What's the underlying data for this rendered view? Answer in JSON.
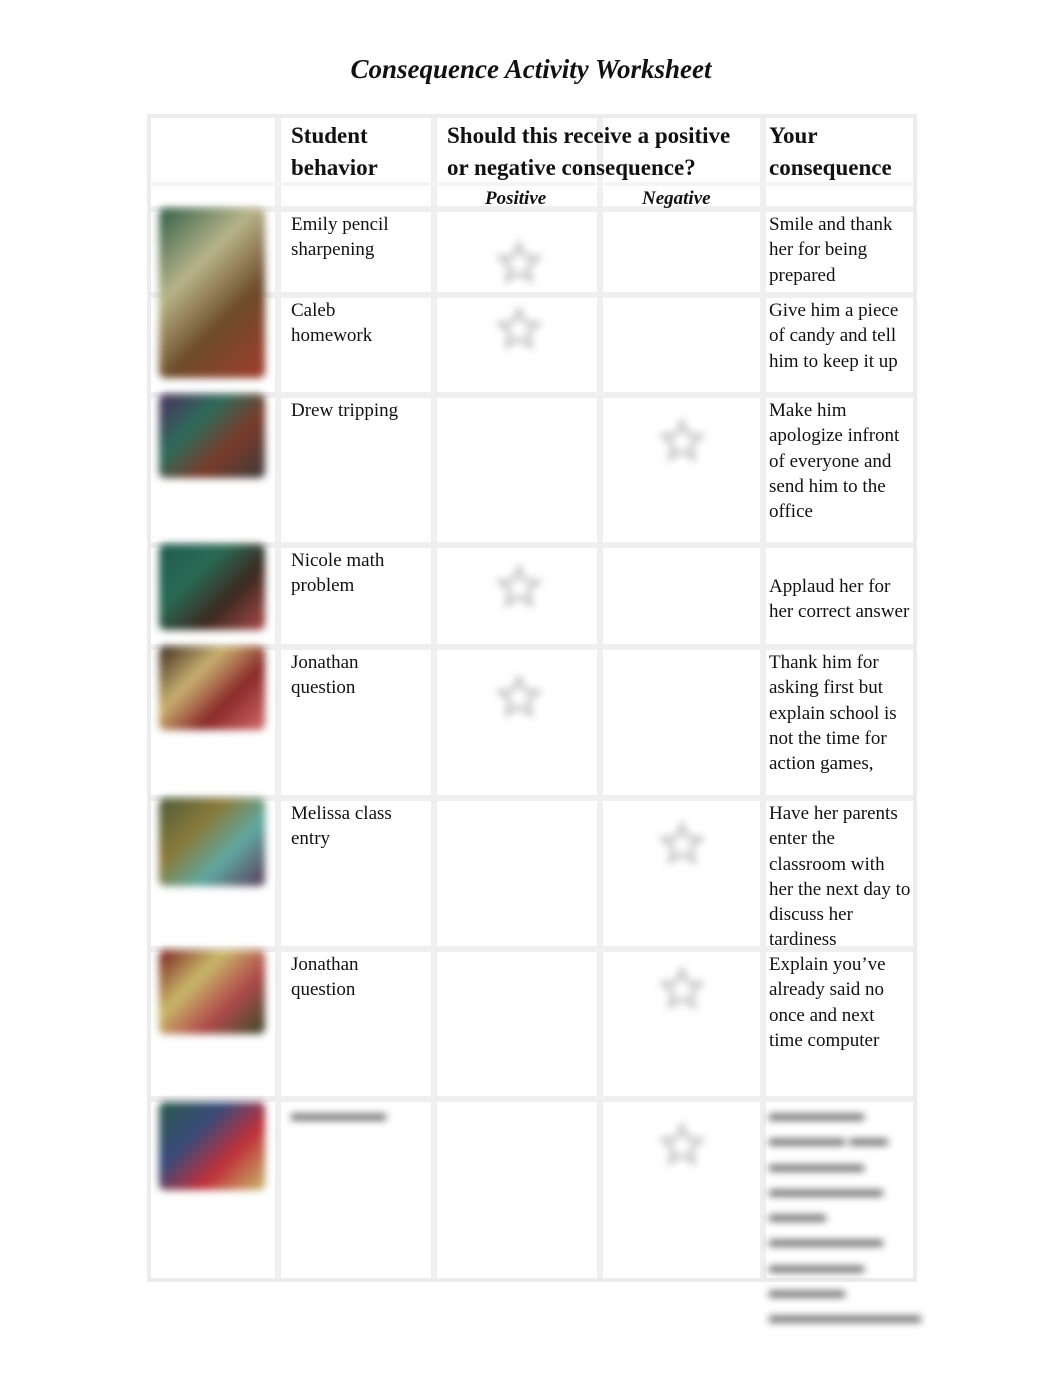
{
  "document": {
    "title": "Consequence Activity Worksheet"
  },
  "table": {
    "headers": {
      "image": "",
      "behavior_line1": "Student",
      "behavior_line2": "behavior",
      "question_line1": "Should this receive a positive",
      "question_line2": "or negative consequence?",
      "consequence_line1": "Your",
      "consequence_line2": "consequence",
      "positive": "Positive",
      "negative": "Negative"
    },
    "rows": [
      {
        "behavior": "Emily pencil sharpening",
        "choice": "positive",
        "consequence": "Smile and thank her for being prepared",
        "thumb_colors": [
          "#2f5d46",
          "#b8b48a",
          "#6c4a2a",
          "#a33c2c"
        ]
      },
      {
        "behavior": "Caleb homework",
        "choice": "positive",
        "consequence": "Give him a piece of candy and tell him to keep it up",
        "thumb_colors": [
          "#6c4a2a",
          "#a33c2c",
          "#b8a65a",
          "#8a3a2b"
        ]
      },
      {
        "behavior": "Drew tripping",
        "choice": "negative",
        "consequence": "Make him apologize infront of everyone and send him to the office",
        "thumb_colors": [
          "#4a2f5e",
          "#2e6b5a",
          "#7a3a2a",
          "#3b3b3b"
        ]
      },
      {
        "behavior": "Nicole math problem",
        "choice": "positive",
        "consequence": "Applaud her for her correct answer",
        "thumb_colors": [
          "#1f5a4c",
          "#2a6a55",
          "#3a2a20",
          "#b04a4a"
        ]
      },
      {
        "behavior": "Jonathan question",
        "choice": "positive",
        "consequence": "Thank him for asking first but explain school is not the time for action games,",
        "thumb_colors": [
          "#3a2a20",
          "#c9b070",
          "#8a2a2a",
          "#d56a6a"
        ]
      },
      {
        "behavior": "Melissa class entry",
        "choice": "negative",
        "consequence": "Have her parents enter the classroom with her the next day to discuss her tardiness",
        "thumb_colors": [
          "#4a5a3a",
          "#8a7a3a",
          "#5fa8a0",
          "#5a3a5a"
        ]
      },
      {
        "behavior": "Jonathan question",
        "choice": "negative",
        "consequence": "Explain you’ve already said no once and next time computer",
        "thumb_colors": [
          "#7a1f1f",
          "#c9b86a",
          "#b04a4a",
          "#3a4a2a"
        ]
      },
      {
        "behavior": "",
        "choice": "negative",
        "consequence": "",
        "thumb_colors": [
          "#2a5a4a",
          "#3a4a7a",
          "#c0303a",
          "#c9b86a"
        ]
      }
    ]
  }
}
